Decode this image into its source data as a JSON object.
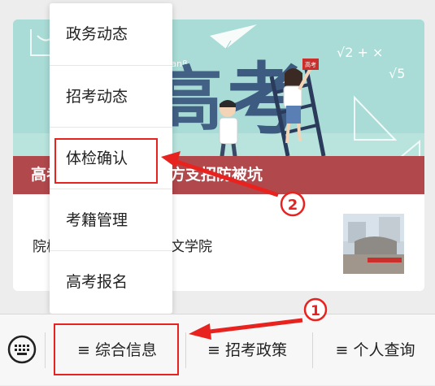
{
  "banner": {
    "caption": "高考考试体检时，警方支招防被坑",
    "art_text": "考",
    "art_text_left": "高",
    "sign_text": "高考",
    "formulas": [
      "√2 + ×",
      "√5",
      "tanβ"
    ]
  },
  "article": {
    "title": "院校：华中科技大学博文学院"
  },
  "menu": {
    "items": [
      {
        "label": "政务动态"
      },
      {
        "label": "招考动态"
      },
      {
        "label": "体检确认"
      },
      {
        "label": "考籍管理"
      },
      {
        "label": "高考报名"
      }
    ]
  },
  "tabbar": {
    "tabs": [
      {
        "label": "≡ 综合信息"
      },
      {
        "label": "≡ 招考政策"
      },
      {
        "label": "≡ 个人查询"
      }
    ]
  },
  "annotations": {
    "step1": "1",
    "step2": "2"
  },
  "colors": {
    "highlight": "#e8231f",
    "banner_bg": "#a9dcd6",
    "caption_bg": "#b0484c"
  },
  "icons": [
    "keyboard-icon",
    "paper-plane-icon",
    "step-1-badge",
    "step-2-badge"
  ]
}
